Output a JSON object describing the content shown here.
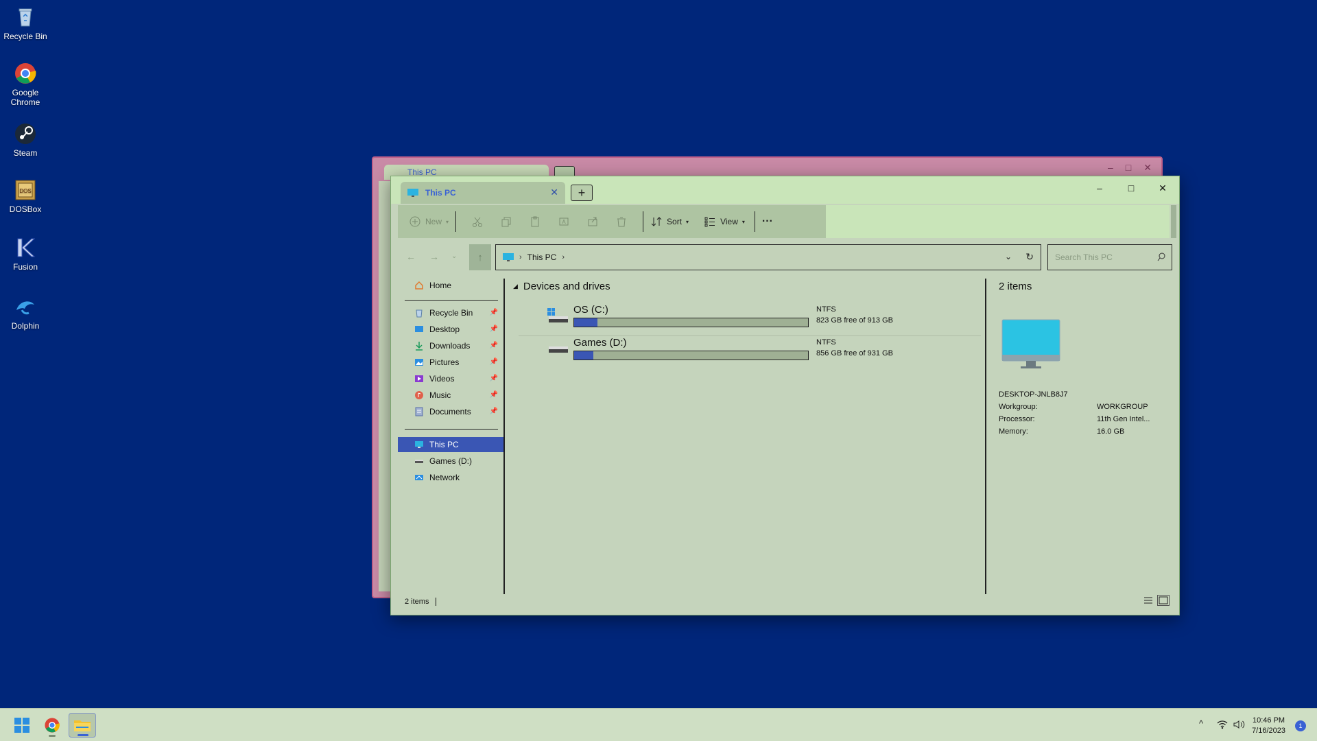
{
  "desktop": {
    "icons": [
      {
        "label": "Recycle Bin"
      },
      {
        "label": "Google Chrome"
      },
      {
        "label": "Steam"
      },
      {
        "label": "DOSBox"
      },
      {
        "label": "Fusion"
      },
      {
        "label": "Dolphin"
      }
    ]
  },
  "back_window": {
    "tab_title": "This PC"
  },
  "window": {
    "tab_title": "This PC",
    "new_tab_label": "+",
    "controls": {
      "minimize": "–",
      "maximize": "□",
      "close": "✕"
    },
    "toolbar": {
      "new_label": "New",
      "sort_label": "Sort",
      "view_label": "View",
      "more_label": "···"
    },
    "address": {
      "crumb": "This PC"
    },
    "search": {
      "placeholder": "Search This PC"
    },
    "sidebar": {
      "home": "Home",
      "pinned": [
        {
          "label": "Recycle Bin",
          "icon": "recycle-bin-icon"
        },
        {
          "label": "Desktop",
          "icon": "desktop-icon"
        },
        {
          "label": "Downloads",
          "icon": "downloads-icon"
        },
        {
          "label": "Pictures",
          "icon": "pictures-icon"
        },
        {
          "label": "Videos",
          "icon": "videos-icon"
        },
        {
          "label": "Music",
          "icon": "music-icon"
        },
        {
          "label": "Documents",
          "icon": "documents-icon"
        }
      ],
      "locations": [
        {
          "label": "This PC",
          "icon": "this-pc-icon",
          "selected": true
        },
        {
          "label": "Games (D:)",
          "icon": "drive-icon"
        },
        {
          "label": "Network",
          "icon": "network-icon"
        }
      ]
    },
    "content": {
      "group_title": "Devices and drives",
      "drives": [
        {
          "name": "OS (C:)",
          "fs": "NTFS",
          "free": "823 GB free of 913 GB",
          "used_fraction": 0.099
        },
        {
          "name": "Games (D:)",
          "fs": "NTFS",
          "free": "856 GB free of 931 GB",
          "used_fraction": 0.081
        }
      ]
    },
    "details": {
      "count": "2 items",
      "pc_name": "DESKTOP-JNLB8J7",
      "props": [
        {
          "k": "Workgroup:",
          "v": "WORKGROUP"
        },
        {
          "k": "Processor:",
          "v": "11th Gen Intel..."
        },
        {
          "k": "Memory:",
          "v": "16.0 GB"
        }
      ]
    },
    "status": {
      "count": "2 items"
    }
  },
  "taskbar": {
    "time": "10:46 PM",
    "date": "7/16/2023",
    "notification_count": "1"
  },
  "colors": {
    "desktop_bg": "#00267a",
    "window_bg": "#c5d4bc",
    "accent": "#3a56b4"
  }
}
